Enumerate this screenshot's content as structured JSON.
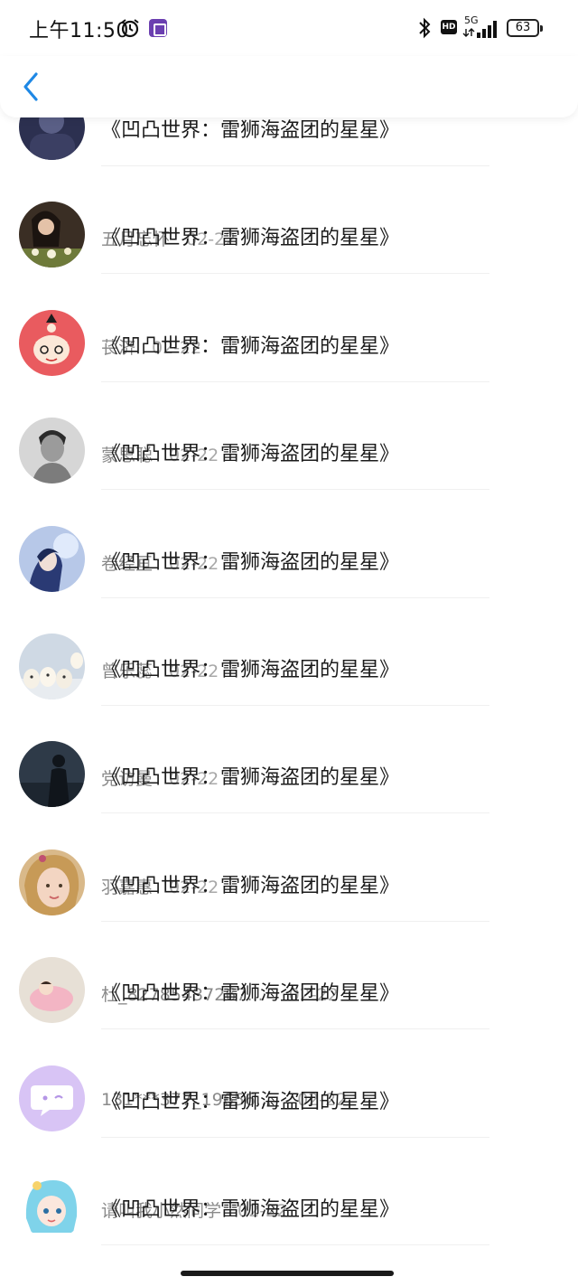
{
  "status_bar": {
    "time": "上午11:50",
    "network": "5G",
    "hd": "HD",
    "battery": "63"
  },
  "nav": {
    "back_icon": "chevron-left-icon"
  },
  "colors": {
    "accent": "#1e88e5",
    "meta_text": "#8a8a8a",
    "title_text": "#1b1b1b"
  },
  "comments": [
    {
      "user": "",
      "date": "",
      "text": "《凹凸世界：雷狮海盗团的星星》",
      "avatar_desc": "dark-blue-figure"
    },
    {
      "user": "五月忘怀",
      "date": "02-22",
      "text": "《凹凸世界：雷狮海盗团的星星》",
      "avatar_desc": "girl-with-flowers"
    },
    {
      "user": "苌济",
      "date": "02-22",
      "text": "《凹凸世界：雷狮海盗团的星星》",
      "avatar_desc": "cartoon-girl-red"
    },
    {
      "user": "蒙思聪",
      "date": "02-22",
      "text": "《凹凸世界：雷狮海盗团的星星》",
      "avatar_desc": "grayscale-man"
    },
    {
      "user": "卷经亘",
      "date": "02-22",
      "text": "《凹凸世界：雷狮海盗团的星星》",
      "avatar_desc": "anime-blue-boy"
    },
    {
      "user": "曾乐蕊",
      "date": "02-22",
      "text": "《凹凸世界：雷狮海盗团的星星》",
      "avatar_desc": "white-puppies"
    },
    {
      "user": "党访曼",
      "date": "02-22",
      "text": "《凹凸世界：雷狮海盗团的星星》",
      "avatar_desc": "silhouette-night"
    },
    {
      "user": "羽嘉惠",
      "date": "02-22",
      "text": "《凹凸世界：雷狮海盗团的星星》",
      "avatar_desc": "blonde-child"
    },
    {
      "user": "杜_82785437267...",
      "date": "02-22",
      "text": "《凹凸世界：雷狮海盗团的星星》",
      "avatar_desc": "baby-pink-blanket"
    },
    {
      "user": "131***377_19656...",
      "date": "02-22",
      "text": "《凹凸世界：雷狮海盗团的星星》",
      "avatar_desc": "default-chat-bubble"
    },
    {
      "user": "请叫我小然同学",
      "date": "02-22",
      "text": "《凹凸世界：雷狮海盗团的星星》",
      "avatar_desc": "anime-cyan-girl"
    }
  ]
}
